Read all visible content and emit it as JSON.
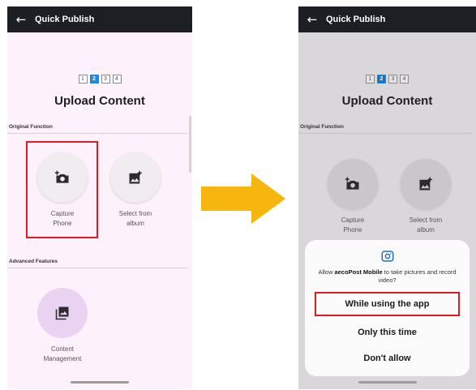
{
  "left_screen": {
    "appbar": {
      "back_icon": "arrow-left-icon",
      "title": "Quick Publish"
    },
    "steps": [
      "1",
      "2",
      "3",
      "4"
    ],
    "active_step": 2,
    "upload_title": "Upload Content",
    "original_section": "Original Function",
    "capture": {
      "label_line1": "Capture",
      "label_line2": "Phone",
      "icon": "camera-add-icon"
    },
    "album": {
      "label_line1": "Select from",
      "label_line2": "album",
      "icon": "image-add-icon"
    },
    "advanced_section": "Advanced Features",
    "content_mgmt": {
      "label_line1": "Content",
      "label_line2": "Management",
      "icon": "photo-library-icon"
    }
  },
  "right_screen": {
    "appbar": {
      "back_icon": "arrow-left-icon",
      "title": "Quick Publish"
    },
    "steps": [
      "1",
      "2",
      "3",
      "4"
    ],
    "active_step": 2,
    "upload_title": "Upload Content",
    "original_section": "Original Function",
    "capture": {
      "label_line1": "Capture",
      "label_line2": "Phone"
    },
    "album": {
      "label_line1": "Select from",
      "label_line2": "album"
    },
    "dialog": {
      "icon": "camera-icon",
      "msg_prefix": "Allow ",
      "app_name": "aecoPost Mobile",
      "msg_suffix": " to take pictures and record video?",
      "btn_while_using": "While using the app",
      "btn_only_this_time": "Only this time",
      "btn_dont_allow": "Don't allow"
    }
  },
  "colors": {
    "highlight": "#e01b24",
    "arrow": "#f6b60e",
    "active_step": "#1e88e5",
    "appbar": "#1c1f24"
  }
}
